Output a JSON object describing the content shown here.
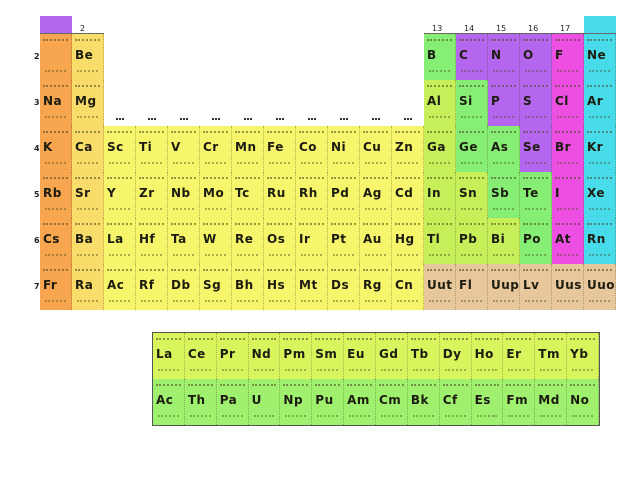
{
  "group_labels": [
    {
      "text": "2",
      "col": 1
    },
    {
      "text": "13",
      "col": 12
    },
    {
      "text": "14",
      "col": 13
    },
    {
      "text": "15",
      "col": 14
    },
    {
      "text": "16",
      "col": 15
    },
    {
      "text": "17",
      "col": 16
    }
  ],
  "period_labels": [
    "2",
    "3",
    "4",
    "5",
    "6",
    "7"
  ],
  "colors": {
    "alkali": "#f7a54e",
    "alkaline": "#f9dd6a",
    "transition": "#f7f56c",
    "post_transition": "#c6ef5a",
    "metalloid": "#86ee74",
    "nonmetal": "#b566ee",
    "halogen": "#ec4fe1",
    "noble": "#48dbea",
    "unknown": "#e8c79c",
    "lanthanide": "#d9f55e",
    "actinide": "#9ff06e"
  },
  "rows": [
    {
      "period": "2",
      "cells": [
        {
          "col": 0,
          "sym": "",
          "cat": "alkali"
        },
        {
          "col": 1,
          "sym": "Be",
          "cat": "alkaline"
        },
        {
          "col": 12,
          "sym": "B",
          "cat": "metalloid"
        },
        {
          "col": 13,
          "sym": "C",
          "cat": "nonmetal"
        },
        {
          "col": 14,
          "sym": "N",
          "cat": "nonmetal"
        },
        {
          "col": 15,
          "sym": "O",
          "cat": "nonmetal"
        },
        {
          "col": 16,
          "sym": "F",
          "cat": "halogen"
        },
        {
          "col": 17,
          "sym": "Ne",
          "cat": "noble"
        }
      ]
    },
    {
      "period": "3",
      "cells": [
        {
          "col": 0,
          "sym": "Na",
          "cat": "alkali"
        },
        {
          "col": 1,
          "sym": "Mg",
          "cat": "alkaline"
        },
        {
          "col": 12,
          "sym": "Al",
          "cat": "post_transition"
        },
        {
          "col": 13,
          "sym": "Si",
          "cat": "metalloid"
        },
        {
          "col": 14,
          "sym": "P",
          "cat": "nonmetal"
        },
        {
          "col": 15,
          "sym": "S",
          "cat": "nonmetal"
        },
        {
          "col": 16,
          "sym": "Cl",
          "cat": "halogen"
        },
        {
          "col": 17,
          "sym": "Ar",
          "cat": "noble"
        }
      ]
    },
    {
      "period": "4",
      "cells": [
        {
          "col": 0,
          "sym": "K",
          "cat": "alkali"
        },
        {
          "col": 1,
          "sym": "Ca",
          "cat": "alkaline"
        },
        {
          "col": 2,
          "sym": "Sc",
          "cat": "transition"
        },
        {
          "col": 3,
          "sym": "Ti",
          "cat": "transition"
        },
        {
          "col": 4,
          "sym": "V",
          "cat": "transition"
        },
        {
          "col": 5,
          "sym": "Cr",
          "cat": "transition"
        },
        {
          "col": 6,
          "sym": "Mn",
          "cat": "transition"
        },
        {
          "col": 7,
          "sym": "Fe",
          "cat": "transition"
        },
        {
          "col": 8,
          "sym": "Co",
          "cat": "transition"
        },
        {
          "col": 9,
          "sym": "Ni",
          "cat": "transition"
        },
        {
          "col": 10,
          "sym": "Cu",
          "cat": "transition"
        },
        {
          "col": 11,
          "sym": "Zn",
          "cat": "transition"
        },
        {
          "col": 12,
          "sym": "Ga",
          "cat": "post_transition"
        },
        {
          "col": 13,
          "sym": "Ge",
          "cat": "metalloid"
        },
        {
          "col": 14,
          "sym": "As",
          "cat": "metalloid"
        },
        {
          "col": 15,
          "sym": "Se",
          "cat": "nonmetal"
        },
        {
          "col": 16,
          "sym": "Br",
          "cat": "halogen"
        },
        {
          "col": 17,
          "sym": "Kr",
          "cat": "noble"
        }
      ]
    },
    {
      "period": "5",
      "cells": [
        {
          "col": 0,
          "sym": "Rb",
          "cat": "alkali"
        },
        {
          "col": 1,
          "sym": "Sr",
          "cat": "alkaline"
        },
        {
          "col": 2,
          "sym": "Y",
          "cat": "transition"
        },
        {
          "col": 3,
          "sym": "Zr",
          "cat": "transition"
        },
        {
          "col": 4,
          "sym": "Nb",
          "cat": "transition"
        },
        {
          "col": 5,
          "sym": "Mo",
          "cat": "transition"
        },
        {
          "col": 6,
          "sym": "Tc",
          "cat": "transition"
        },
        {
          "col": 7,
          "sym": "Ru",
          "cat": "transition"
        },
        {
          "col": 8,
          "sym": "Rh",
          "cat": "transition"
        },
        {
          "col": 9,
          "sym": "Pd",
          "cat": "transition"
        },
        {
          "col": 10,
          "sym": "Ag",
          "cat": "transition"
        },
        {
          "col": 11,
          "sym": "Cd",
          "cat": "transition"
        },
        {
          "col": 12,
          "sym": "In",
          "cat": "post_transition"
        },
        {
          "col": 13,
          "sym": "Sn",
          "cat": "post_transition"
        },
        {
          "col": 14,
          "sym": "Sb",
          "cat": "metalloid"
        },
        {
          "col": 15,
          "sym": "Te",
          "cat": "metalloid"
        },
        {
          "col": 16,
          "sym": "I",
          "cat": "halogen"
        },
        {
          "col": 17,
          "sym": "Xe",
          "cat": "noble"
        }
      ]
    },
    {
      "period": "6",
      "cells": [
        {
          "col": 0,
          "sym": "Cs",
          "cat": "alkali"
        },
        {
          "col": 1,
          "sym": "Ba",
          "cat": "alkaline"
        },
        {
          "col": 2,
          "sym": "La",
          "cat": "transition"
        },
        {
          "col": 3,
          "sym": "Hf",
          "cat": "transition"
        },
        {
          "col": 4,
          "sym": "Ta",
          "cat": "transition"
        },
        {
          "col": 5,
          "sym": "W",
          "cat": "transition"
        },
        {
          "col": 6,
          "sym": "Re",
          "cat": "transition"
        },
        {
          "col": 7,
          "sym": "Os",
          "cat": "transition"
        },
        {
          "col": 8,
          "sym": "Ir",
          "cat": "transition"
        },
        {
          "col": 9,
          "sym": "Pt",
          "cat": "transition"
        },
        {
          "col": 10,
          "sym": "Au",
          "cat": "transition"
        },
        {
          "col": 11,
          "sym": "Hg",
          "cat": "transition"
        },
        {
          "col": 12,
          "sym": "Tl",
          "cat": "post_transition"
        },
        {
          "col": 13,
          "sym": "Pb",
          "cat": "post_transition"
        },
        {
          "col": 14,
          "sym": "Bi",
          "cat": "post_transition"
        },
        {
          "col": 15,
          "sym": "Po",
          "cat": "metalloid"
        },
        {
          "col": 16,
          "sym": "At",
          "cat": "halogen"
        },
        {
          "col": 17,
          "sym": "Rn",
          "cat": "noble"
        }
      ]
    },
    {
      "period": "7",
      "cells": [
        {
          "col": 0,
          "sym": "Fr",
          "cat": "alkali"
        },
        {
          "col": 1,
          "sym": "Ra",
          "cat": "alkaline"
        },
        {
          "col": 2,
          "sym": "Ac",
          "cat": "transition"
        },
        {
          "col": 3,
          "sym": "Rf",
          "cat": "transition"
        },
        {
          "col": 4,
          "sym": "Db",
          "cat": "transition"
        },
        {
          "col": 5,
          "sym": "Sg",
          "cat": "transition"
        },
        {
          "col": 6,
          "sym": "Bh",
          "cat": "transition"
        },
        {
          "col": 7,
          "sym": "Hs",
          "cat": "transition"
        },
        {
          "col": 8,
          "sym": "Mt",
          "cat": "transition"
        },
        {
          "col": 9,
          "sym": "Ds",
          "cat": "transition"
        },
        {
          "col": 10,
          "sym": "Rg",
          "cat": "transition"
        },
        {
          "col": 11,
          "sym": "Cn",
          "cat": "transition"
        },
        {
          "col": 12,
          "sym": "Uut",
          "cat": "unknown"
        },
        {
          "col": 13,
          "sym": "Fl",
          "cat": "unknown"
        },
        {
          "col": 14,
          "sym": "Uup",
          "cat": "unknown"
        },
        {
          "col": 15,
          "sym": "Lv",
          "cat": "unknown"
        },
        {
          "col": 16,
          "sym": "Uus",
          "cat": "unknown"
        },
        {
          "col": 17,
          "sym": "Uuo",
          "cat": "unknown"
        }
      ]
    }
  ],
  "lanthanides": [
    "La",
    "Ce",
    "Pr",
    "Nd",
    "Pm",
    "Sm",
    "Eu",
    "Gd",
    "Tb",
    "Dy",
    "Ho",
    "Er",
    "Tm",
    "Yb"
  ],
  "actinides": [
    "Ac",
    "Th",
    "Pa",
    "U",
    "Np",
    "Pu",
    "Am",
    "Cm",
    "Bk",
    "Cf",
    "Es",
    "Fm",
    "Md",
    "No"
  ]
}
